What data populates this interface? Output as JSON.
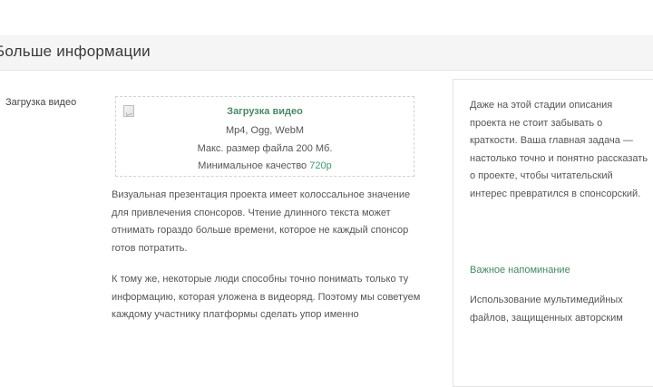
{
  "section": {
    "title": "Больше информации"
  },
  "video_field": {
    "label": "Загрузка видео"
  },
  "upload": {
    "title": "Загрузка видео",
    "formats": "Mp4, Ogg, WebM",
    "max_size": "Макс. размер файла 200 Мб.",
    "quality_prefix": "Минимальное качество ",
    "quality_value": "720p"
  },
  "description": {
    "paragraph_1": "Визуальная презентация проекта имеет колоссальное значение для привлечения спонсоров. Чтение длинного текста может отнимать гораздо больше времени, которое не каждый спонсор готов потратить.",
    "paragraph_2": "К тому же, некоторые люди способны точно понимать только ту информацию, которая уложена в видеоряд. Поэтому мы советуем каждому участнику платформы сделать упор именно"
  },
  "sidebar": {
    "intro": "Даже на этой стадии описания проекта не стоит забывать о краткости. Ваша главная задача — настолько точно и понятно рассказать о проекте, чтобы читательский интерес превратился в спонсорский.",
    "heading": "Важное напоминание",
    "note": "Использование мультимедийных файлов, защищенных авторским"
  },
  "colors": {
    "accent": "#3aa06a",
    "heading_green": "#3f8a5e",
    "header_bg": "#f5f5f5"
  }
}
